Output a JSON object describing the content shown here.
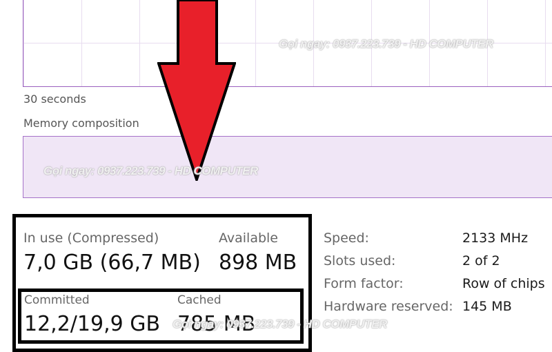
{
  "graph": {
    "time_label": "30 seconds",
    "composition_label": "Memory composition"
  },
  "stats": {
    "in_use_label": "In use (Compressed)",
    "in_use_value": "7,0 GB (66,7 MB)",
    "available_label": "Available",
    "available_value": "898 MB",
    "committed_label": "Committed",
    "committed_value": "12,2/19,9 GB",
    "cached_label": "Cached",
    "cached_value": "785 MB"
  },
  "properties": [
    {
      "label": "Speed:",
      "value": "2133 MHz"
    },
    {
      "label": "Slots used:",
      "value": "2 of 2"
    },
    {
      "label": "Form factor:",
      "value": "Row of chips"
    },
    {
      "label": "Hardware reserved:",
      "value": "145 MB"
    }
  ],
  "watermark": "Gọi ngay: 0937.223.739 - HD COMPUTER",
  "colors": {
    "graph_line": "#9a5fbf",
    "composition_fill": "#f0e6f6",
    "arrow_red": "#e8202a",
    "highlight_box": "#000000"
  }
}
